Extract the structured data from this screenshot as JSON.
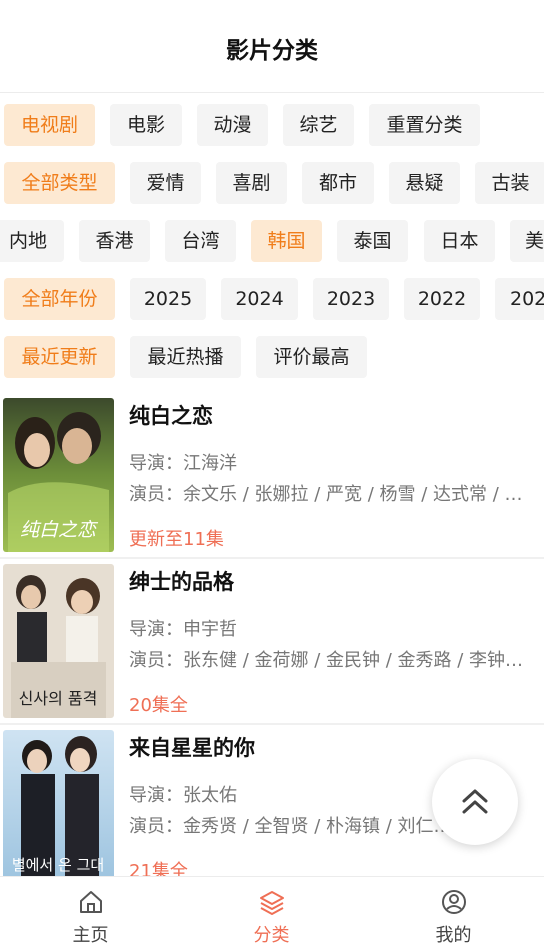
{
  "header": {
    "title": "影片分类"
  },
  "filters": {
    "category": [
      "电视剧",
      "电影",
      "动漫",
      "综艺",
      "重置分类"
    ],
    "genre": [
      "全部类型",
      "爱情",
      "喜剧",
      "都市",
      "悬疑",
      "古装"
    ],
    "region": [
      "内地",
      "香港",
      "台湾",
      "韩国",
      "泰国",
      "日本",
      "美"
    ],
    "year": [
      "全部年份",
      "2025",
      "2024",
      "2023",
      "2022",
      "202"
    ],
    "sort": [
      "最近更新",
      "最近热播",
      "评价最高"
    ]
  },
  "items": [
    {
      "title": "纯白之恋",
      "director": "导演：江海洋",
      "actors": "演员：余文乐 / 张娜拉 / 严宽 / 杨雪 / 达式常 / 王…",
      "status": "更新至11集",
      "poster_text": "纯白之恋"
    },
    {
      "title": "绅士的品格",
      "director": "导演：申宇哲",
      "actors": "演员：张东健 / 金荷娜 / 金民钟 / 金秀路 / 李钟…",
      "status": "20集全",
      "poster_text": "신사의 품격"
    },
    {
      "title": "来自星星的你",
      "director": "导演：张太佑",
      "actors": "演员：金秀贤 / 全智贤 / 朴海镇 / 刘仁…",
      "status": "21集全",
      "poster_text": "별에서 온 그대"
    }
  ],
  "tabbar": {
    "home": "主页",
    "category": "分类",
    "mine": "我的"
  },
  "colors": {
    "accent": "#f07d1a",
    "active_bg": "#fde9d2",
    "highlight": "#ef6f55"
  }
}
